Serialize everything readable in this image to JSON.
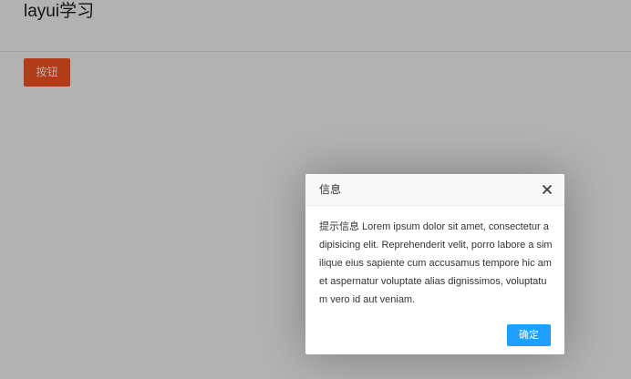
{
  "page": {
    "title": "layui学习",
    "button_label": "按钮"
  },
  "dialog": {
    "title": "信息",
    "close_icon": "close-icon",
    "content": "提示信息 Lorem ipsum dolor sit amet, consectetur adipisicing elit. Reprehenderit velit, porro labore a similique eius sapiente cum accusamus tempore hic amet aspernatur voluptate alias dignissimos, voluptatum vero id aut veniam.",
    "confirm_label": "确定"
  },
  "colors": {
    "primary_button": "#ff5722",
    "confirm_button": "#1e9fff",
    "overlay": "rgba(0,0,0,0.3)"
  }
}
